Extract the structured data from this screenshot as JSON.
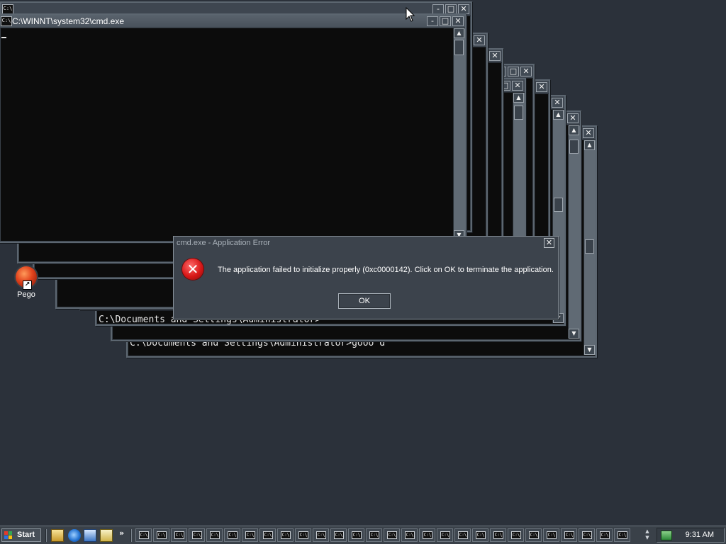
{
  "main_window": {
    "title": "C:\\WINNT\\system32\\cmd.exe",
    "icon_text": "C:\\"
  },
  "behind_console": {
    "line1": "C:\\Documents and Settings\\Administrator>",
    "line2": "C:\\Documents and Settings\\Administrator>gooo d"
  },
  "window_controls": {
    "minimize": "-",
    "maximize": "□",
    "close": "✕"
  },
  "desktop_icon": {
    "label": "Pego"
  },
  "dialog": {
    "title": "cmd.exe - Application Error",
    "message": "The application failed to initialize properly (0xc0000142). Click on OK to terminate the application.",
    "ok_label": "OK",
    "close_label": "✕",
    "error_glyph": "✕"
  },
  "taskbar": {
    "start_label": "Start",
    "chevron": "»",
    "task_button_icon_text": "C:\\",
    "task_button_count": 28,
    "scroll_up": "▲",
    "scroll_down": "▼",
    "clock": "9:31 AM"
  },
  "colors": {
    "desktop": "#2b313a",
    "window_frame": "#5c6670",
    "console_background": "#0c0c0c",
    "dialog_background": "#3c434c",
    "error_red": "#d81818"
  },
  "icons": {
    "pointer": "arrow-pointer-icon",
    "error": "error-x-icon",
    "app": "pego-app-icon"
  }
}
